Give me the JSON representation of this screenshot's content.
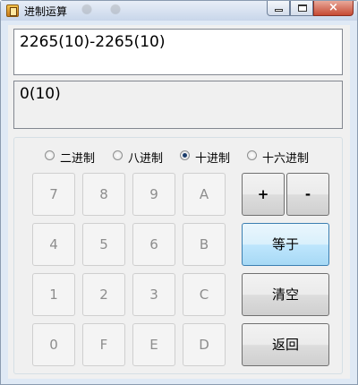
{
  "window": {
    "title": "进制运算",
    "controls": {
      "minimize": "minimize-icon",
      "maximize": "maximize-icon",
      "close": "×"
    }
  },
  "display": {
    "expression": "2265(10)-2265(10)",
    "result": "0(10)"
  },
  "bases": [
    {
      "label": "二进制",
      "selected": false
    },
    {
      "label": "八进制",
      "selected": false
    },
    {
      "label": "十进制",
      "selected": true
    },
    {
      "label": "十六进制",
      "selected": false
    }
  ],
  "keys": {
    "row1": [
      "7",
      "8",
      "9",
      "A"
    ],
    "row2": [
      "4",
      "5",
      "6",
      "B"
    ],
    "row3": [
      "1",
      "2",
      "3",
      "C"
    ],
    "row4": [
      "0",
      "F",
      "E",
      "D"
    ]
  },
  "operators": {
    "plus": "+",
    "minus": "-",
    "equals": "等于",
    "clear": "清空",
    "back": "返回"
  },
  "colors": {
    "equals_border": "#3c7fb1",
    "disabled_text": "#8d8d8d"
  }
}
